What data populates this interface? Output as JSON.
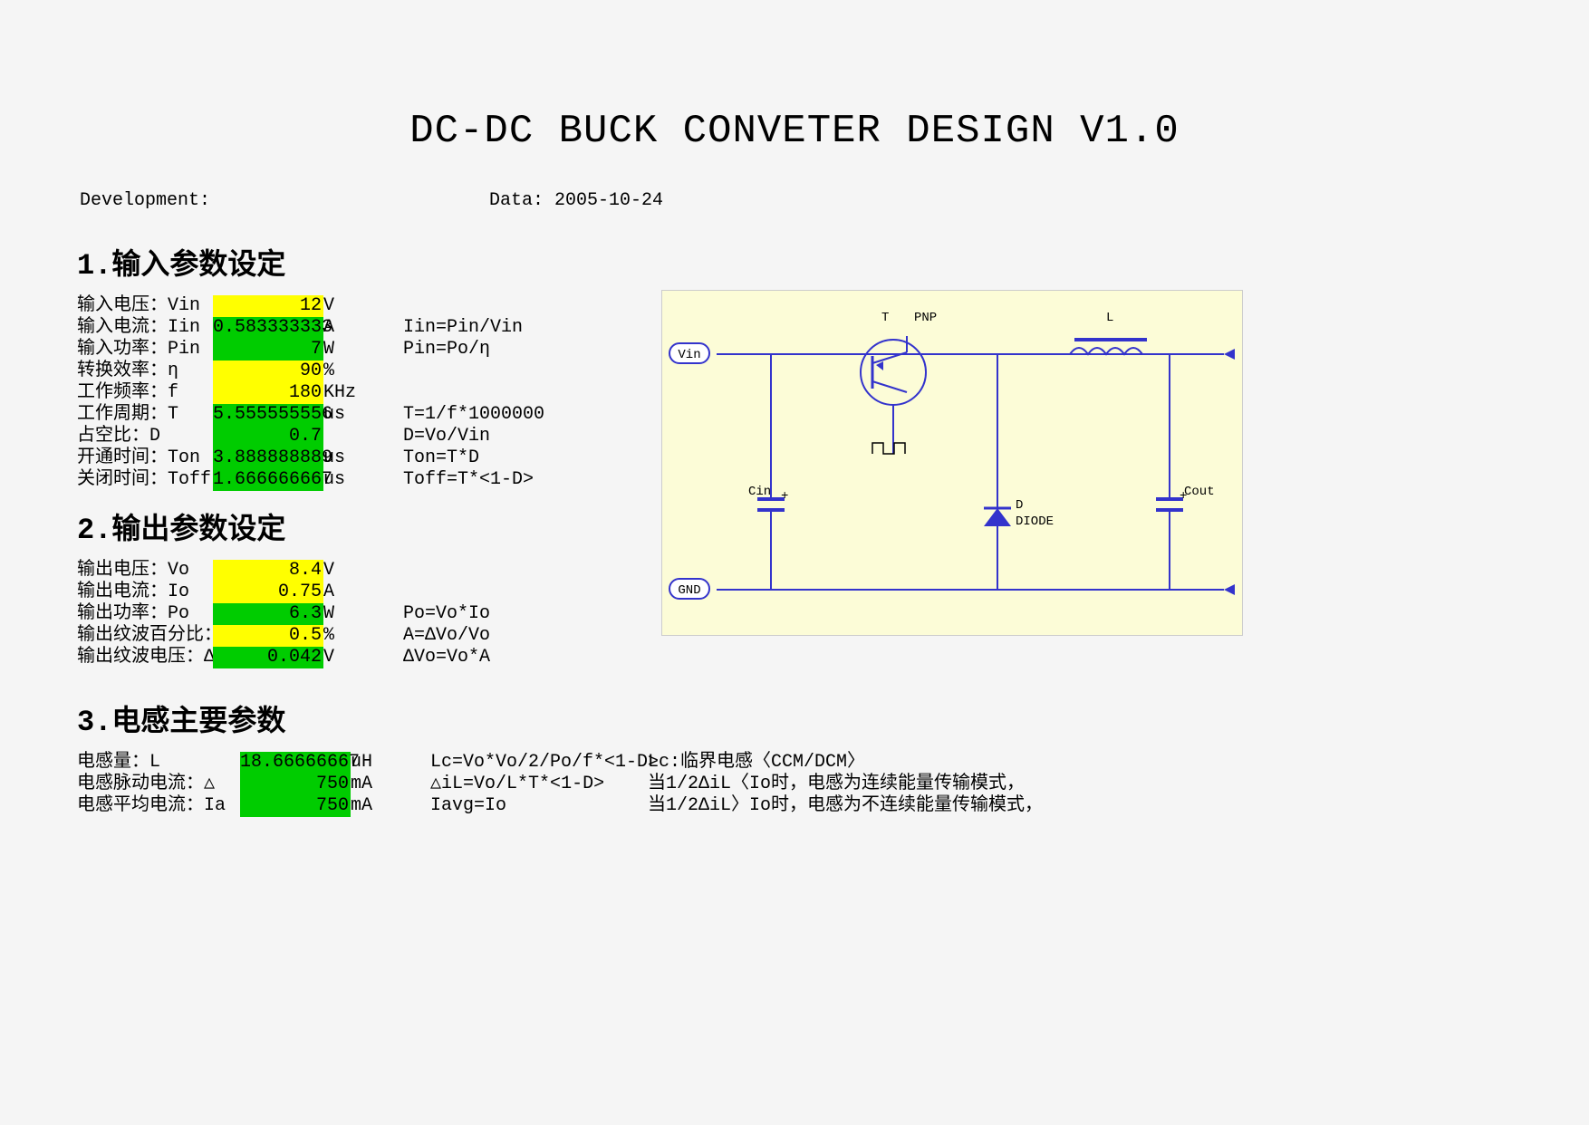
{
  "title": "DC-DC   BUCK   CONVETER    DESIGN   V1.0",
  "meta": {
    "dev": "Development:",
    "date": "Data: 2005-10-24"
  },
  "sections": {
    "s1": "1.输入参数设定",
    "s2": "2.输出参数设定",
    "s3": "3.电感主要参数"
  },
  "t1": [
    {
      "lab": "输入电压：Vin",
      "val": "12",
      "cls": "y",
      "unit": "V",
      "form": ""
    },
    {
      "lab": "输入电流：Iin",
      "val": "0.583333333",
      "cls": "g",
      "unit": "A",
      "form": "Iin=Pin/Vin"
    },
    {
      "lab": "输入功率：Pin",
      "val": "7",
      "cls": "g",
      "unit": "W",
      "form": "Pin=Po/η"
    },
    {
      "lab": "转换效率：η",
      "val": "90",
      "cls": "y",
      "unit": "%",
      "form": ""
    },
    {
      "lab": "工作频率：f",
      "val": "180",
      "cls": "y",
      "unit": "KHz",
      "form": ""
    },
    {
      "lab": "工作周期：T",
      "val": "5.555555556",
      "cls": "g",
      "unit": "us",
      "form": "T=1/f*1000000"
    },
    {
      "lab": "占空比：D",
      "val": "0.7",
      "cls": "g",
      "unit": "",
      "form": "D=Vo/Vin"
    },
    {
      "lab": "开通时间：Ton",
      "val": "3.888888889",
      "cls": "g",
      "unit": "us",
      "form": "Ton=T*D"
    },
    {
      "lab": "关闭时间：Toff",
      "val": "1.666666667",
      "cls": "g",
      "unit": "us",
      "form": "Toff=T*<1-D>"
    }
  ],
  "t2": [
    {
      "lab": "输出电压：Vo",
      "val": "8.4",
      "cls": "y",
      "unit": "V",
      "form": ""
    },
    {
      "lab": "输出电流：Io",
      "val": "0.75",
      "cls": "y",
      "unit": "A",
      "form": ""
    },
    {
      "lab": "输出功率：Po",
      "val": "6.3",
      "cls": "g",
      "unit": "W",
      "form": "Po=Vo*Io"
    },
    {
      "lab": "输出纹波百分比：",
      "val": "0.5",
      "cls": "y",
      "unit": "%",
      "form": "A=ΔVo/Vo"
    },
    {
      "lab": "输出纹波电压：Δ",
      "val": "0.042",
      "cls": "g",
      "unit": "V",
      "form": "ΔVo=Vo*A"
    }
  ],
  "t3": [
    {
      "lab": "电感量：L",
      "val": "18.66666667",
      "cls": "g",
      "unit": "uH",
      "form": "Lc=Vo*Vo/2/Po/f*<1-D>",
      "note": "Lc:临界电感〈CCM/DCM〉"
    },
    {
      "lab": "电感脉动电流：△",
      "val": "750",
      "cls": "g",
      "unit": "mA",
      "form": "△iL=Vo/L*T*<1-D>",
      "note": "当1/2ΔiL〈Io时，电感为连续能量传输模式，"
    },
    {
      "lab": "电感平均电流：Ia",
      "val": "750",
      "cls": "g",
      "unit": "mA",
      "form": "Iavg=Io",
      "note": "当1/2ΔiL〉Io时，电感为不连续能量传输模式，"
    }
  ],
  "schm": {
    "vin": "Vin",
    "gnd": "GND",
    "cin": "Cin",
    "t": "T",
    "pnp": "PNP",
    "d": "D",
    "diode": "DIODE",
    "l": "L",
    "cout": "Cout"
  }
}
